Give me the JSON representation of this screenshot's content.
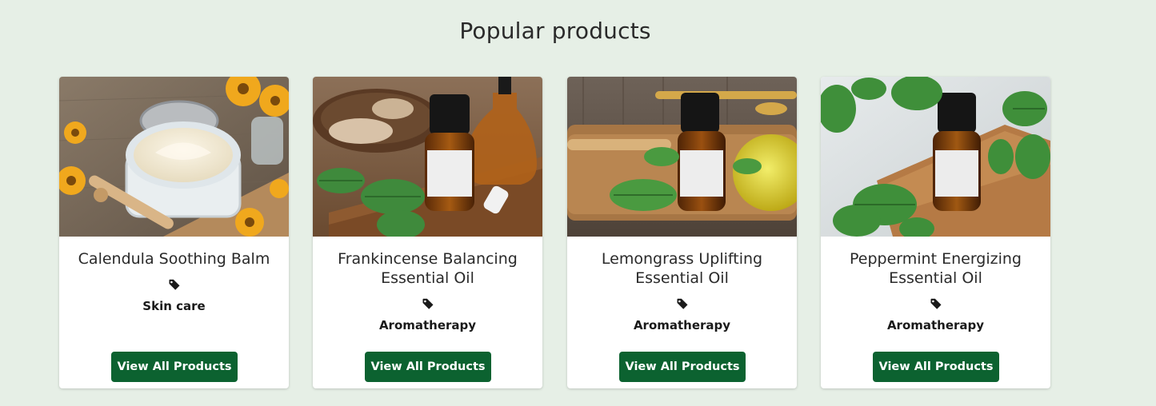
{
  "section": {
    "title": "Popular products"
  },
  "products": [
    {
      "name": "Calendula Soothing Balm",
      "category": "Skin care",
      "button_label": "View All Products",
      "image_icon": "calendula-balm-jar-photo"
    },
    {
      "name": "Frankincense Balancing Essential Oil",
      "category": "Aromatherapy",
      "button_label": "View All Products",
      "image_icon": "frankincense-oil-bottle-photo"
    },
    {
      "name": "Lemongrass Uplifting Essential Oil",
      "category": "Aromatherapy",
      "button_label": "View All Products",
      "image_icon": "lemongrass-oil-bottle-photo"
    },
    {
      "name": "Peppermint Energizing Essential Oil",
      "category": "Aromatherapy",
      "button_label": "View All Products",
      "image_icon": "peppermint-oil-bottle-photo"
    }
  ],
  "colors": {
    "background": "#e6efe6",
    "card": "#ffffff",
    "button": "#0c6230",
    "button_text": "#ffffff"
  }
}
